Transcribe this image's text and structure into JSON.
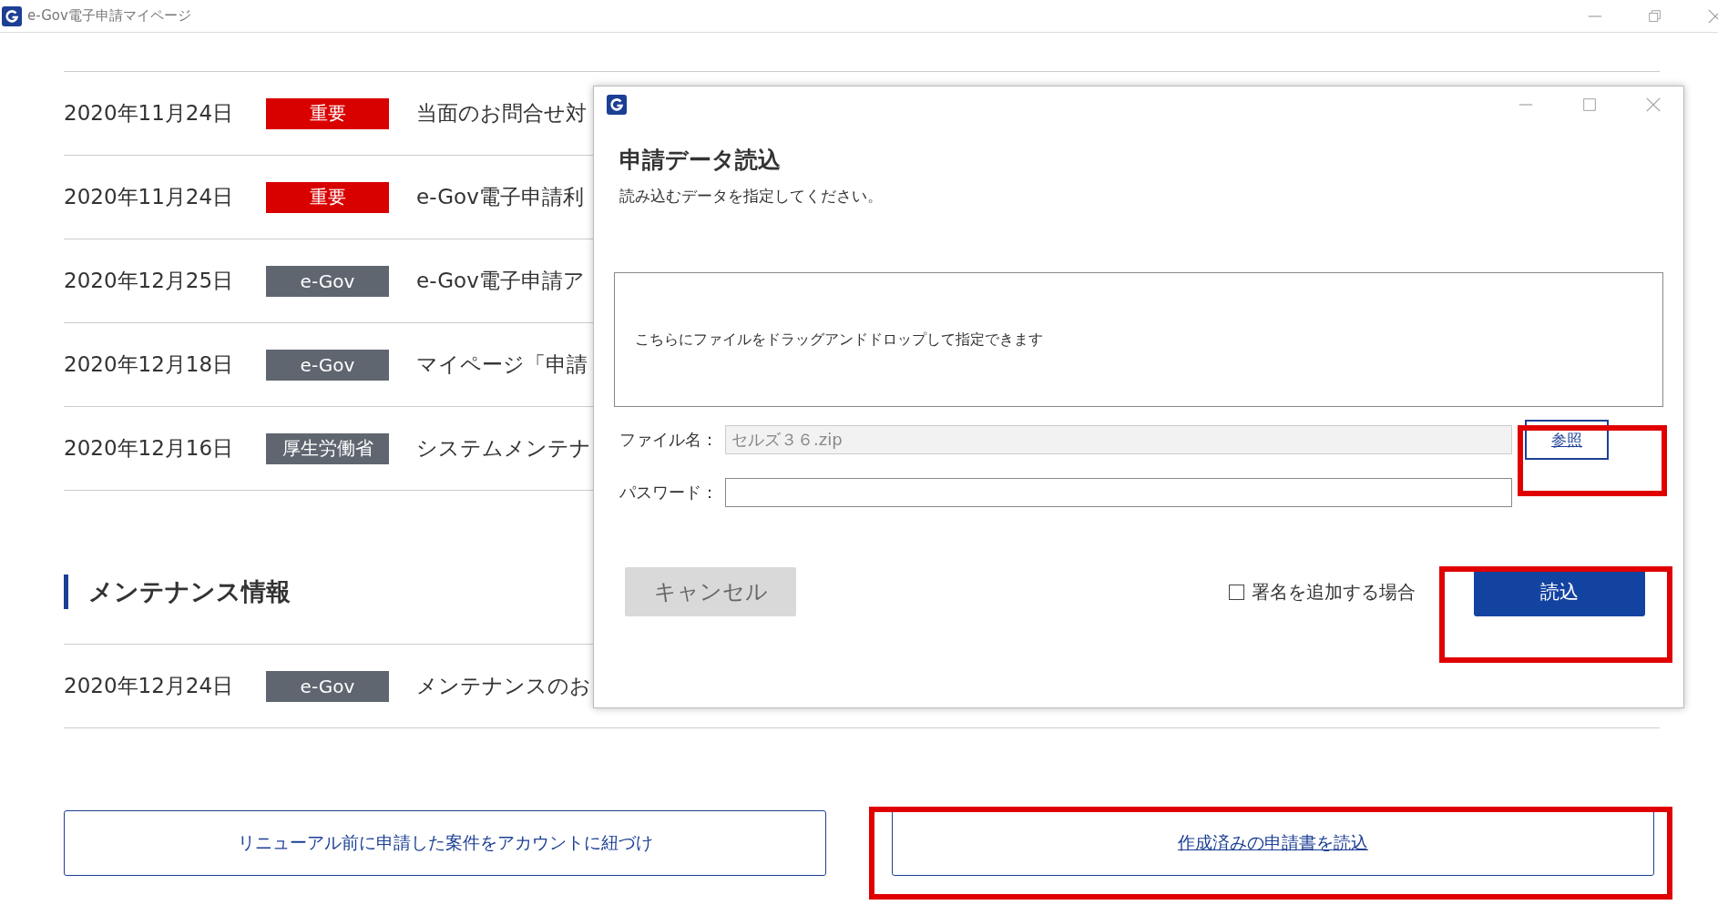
{
  "window": {
    "title": "e-Gov電子申請マイページ"
  },
  "news": [
    {
      "date": "2020年11月24日",
      "tag": "重要",
      "color": "#d90000",
      "title": "当面のお問合せ対"
    },
    {
      "date": "2020年11月24日",
      "tag": "重要",
      "color": "#d90000",
      "title": "e-Gov電子申請利"
    },
    {
      "date": "2020年12月25日",
      "tag": "e-Gov",
      "color": "#5f6670",
      "title": "e-Gov電子申請ア"
    },
    {
      "date": "2020年12月18日",
      "tag": "e-Gov",
      "color": "#5f6670",
      "title": "マイページ「申請"
    },
    {
      "date": "2020年12月16日",
      "tag": "厚生労働省",
      "color": "#5f6670",
      "title": "システムメンテナ"
    }
  ],
  "maintenance": {
    "heading": "メンテナンス情報",
    "items": [
      {
        "date": "2020年12月24日",
        "tag": "e-Gov",
        "color": "#5f6670",
        "title": "メンテナンスのお"
      }
    ]
  },
  "buttons": [
    {
      "label": "リニューアル前に申請した案件をアカウントに紐づけ",
      "kind": "plain"
    },
    {
      "label": "作成済みの申請書を読込",
      "kind": "link"
    }
  ],
  "dialog": {
    "title": "申請データ読込",
    "subtitle": "読み込むデータを指定してください。",
    "drop_hint": "こちらにファイルをドラッグアンドドロップして指定できます",
    "file_label": "ファイル名：",
    "file_value": "セルズ３６.zip",
    "browse_button": "参照",
    "password_label": "パスワード：",
    "cancel_button": "キャンセル",
    "sign_checkbox": {
      "label": "署名を追加する場合",
      "checked": false
    },
    "read_button": "読込"
  }
}
